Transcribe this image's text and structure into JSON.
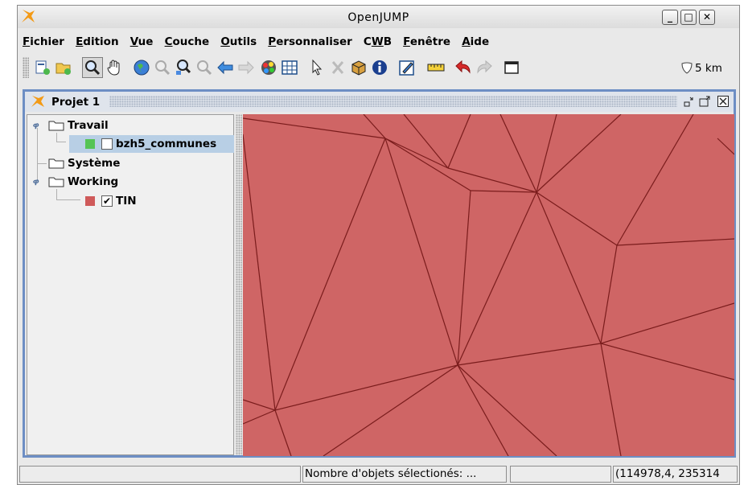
{
  "window": {
    "title": "OpenJUMP",
    "controls": {
      "minimize": "_",
      "maximize": "□",
      "close": "✕"
    }
  },
  "menu": [
    {
      "ul": "F",
      "rest": "ichier"
    },
    {
      "ul": "E",
      "rest": "dition"
    },
    {
      "ul": "V",
      "rest": "ue"
    },
    {
      "ul": "C",
      "rest": "ouche"
    },
    {
      "ul": "O",
      "rest": "utils"
    },
    {
      "ul": "P",
      "rest": "ersonnaliser"
    },
    {
      "pre": "C",
      "ul": "W",
      "rest": "B"
    },
    {
      "ul": "F",
      "rest": "enêtre"
    },
    {
      "ul": "A",
      "rest": "ide"
    }
  ],
  "toolbar": {
    "scale": "5 km",
    "icons": [
      "new-category-icon",
      "open-project-icon",
      "zoom-tool-icon",
      "pan-hand-icon",
      "zoom-full-extent-icon",
      "zoom-in-icon",
      "zoom-to-selected-icon",
      "zoom-previous-icon",
      "zoom-back-arrow-icon",
      "zoom-forward-arrow-icon",
      "color-palette-icon",
      "grid-table-icon",
      "select-pointer-icon",
      "delete-tools-icon",
      "box-icon",
      "info-icon",
      "edit-pencil-icon",
      "ruler-icon",
      "undo-icon",
      "redo-icon",
      "frame-window-icon",
      "scale-shield-icon"
    ]
  },
  "project": {
    "title": "Projet 1",
    "tree": {
      "travail": "Travail",
      "layer1": "bzh5_communes",
      "systeme": "Système",
      "working": "Working",
      "layer2": "TIN",
      "layer2_checked": "✔"
    }
  },
  "colors": {
    "map_fill": "#cf6565",
    "map_edge": "#7a1c1c",
    "layer1_swatch": "#55c455",
    "layer2_swatch": "#cf5a5a",
    "frame_border": "#6d8ec4"
  },
  "status": {
    "selected_objects": "Nombre d'objets sélectionés: ...",
    "coordinates": "(114978,4, 235314"
  }
}
